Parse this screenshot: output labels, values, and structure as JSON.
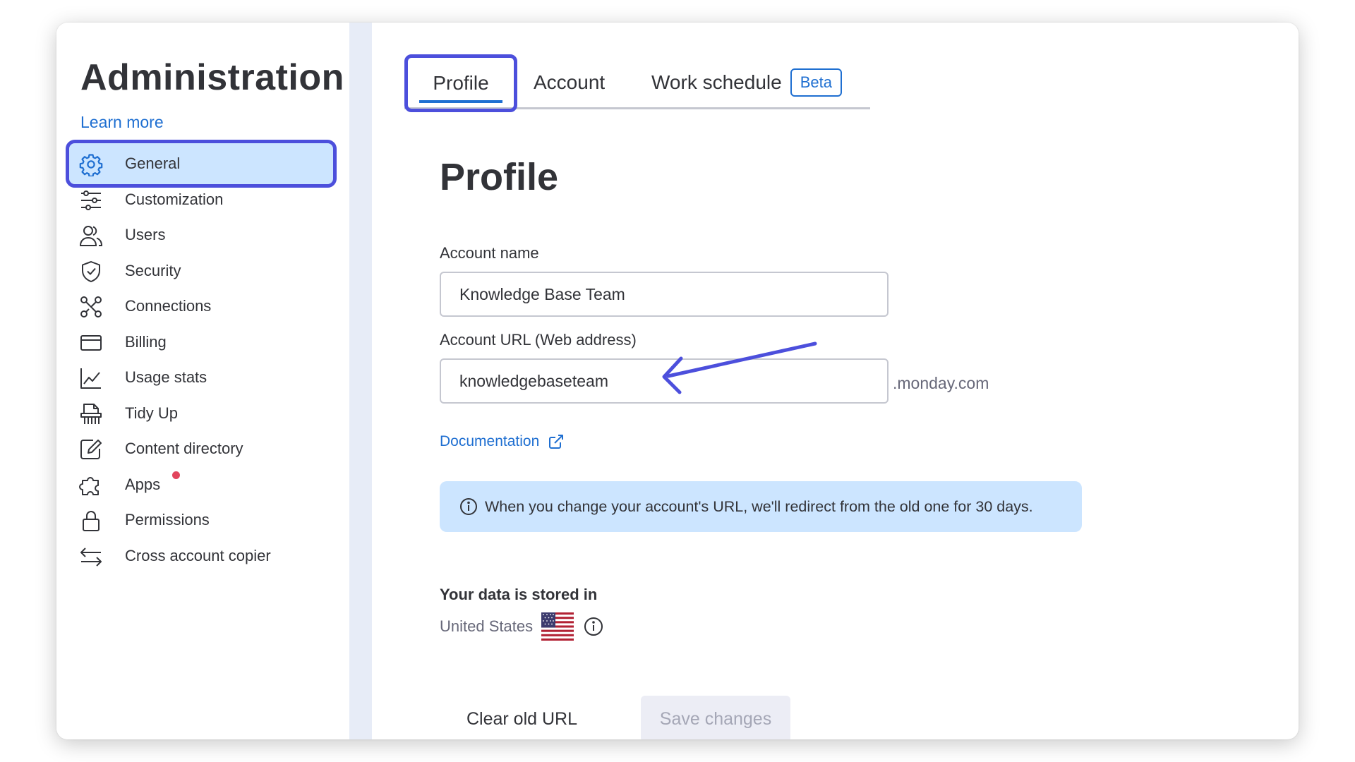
{
  "sidebar": {
    "title": "Administration",
    "learn_more": "Learn more",
    "items": [
      {
        "label": "General",
        "icon": "gear-icon",
        "active": true
      },
      {
        "label": "Customization",
        "icon": "sliders-icon"
      },
      {
        "label": "Users",
        "icon": "users-icon"
      },
      {
        "label": "Security",
        "icon": "shield-icon"
      },
      {
        "label": "Connections",
        "icon": "connections-icon"
      },
      {
        "label": "Billing",
        "icon": "credit-card-icon"
      },
      {
        "label": "Usage stats",
        "icon": "chart-icon"
      },
      {
        "label": "Tidy Up",
        "icon": "shredder-icon"
      },
      {
        "label": "Content directory",
        "icon": "edit-document-icon"
      },
      {
        "label": "Apps",
        "icon": "puzzle-icon",
        "notification_dot": true
      },
      {
        "label": "Permissions",
        "icon": "lock-icon"
      },
      {
        "label": "Cross account copier",
        "icon": "arrows-swap-icon"
      }
    ]
  },
  "tabs": [
    {
      "label": "Profile",
      "active": true
    },
    {
      "label": "Account"
    },
    {
      "label": "Work schedule",
      "badge": "Beta"
    }
  ],
  "profile": {
    "title": "Profile",
    "account_name_label": "Account name",
    "account_name_value": "Knowledge Base Team",
    "account_url_label": "Account URL (Web address)",
    "account_url_value": "knowledgebaseteam",
    "url_suffix": ".monday.com",
    "documentation_link": "Documentation",
    "info_banner": "When you change your account's URL, we'll redirect from the old one for 30 days.",
    "storage_heading": "Your data is stored in",
    "storage_country": "United States",
    "clear_button": "Clear old URL",
    "save_button": "Save changes"
  },
  "colors": {
    "accent": "#1f6fd1",
    "highlight_outline": "#4c4fdc",
    "active_bg": "#cce5ff",
    "notification_dot": "#e2445c"
  }
}
